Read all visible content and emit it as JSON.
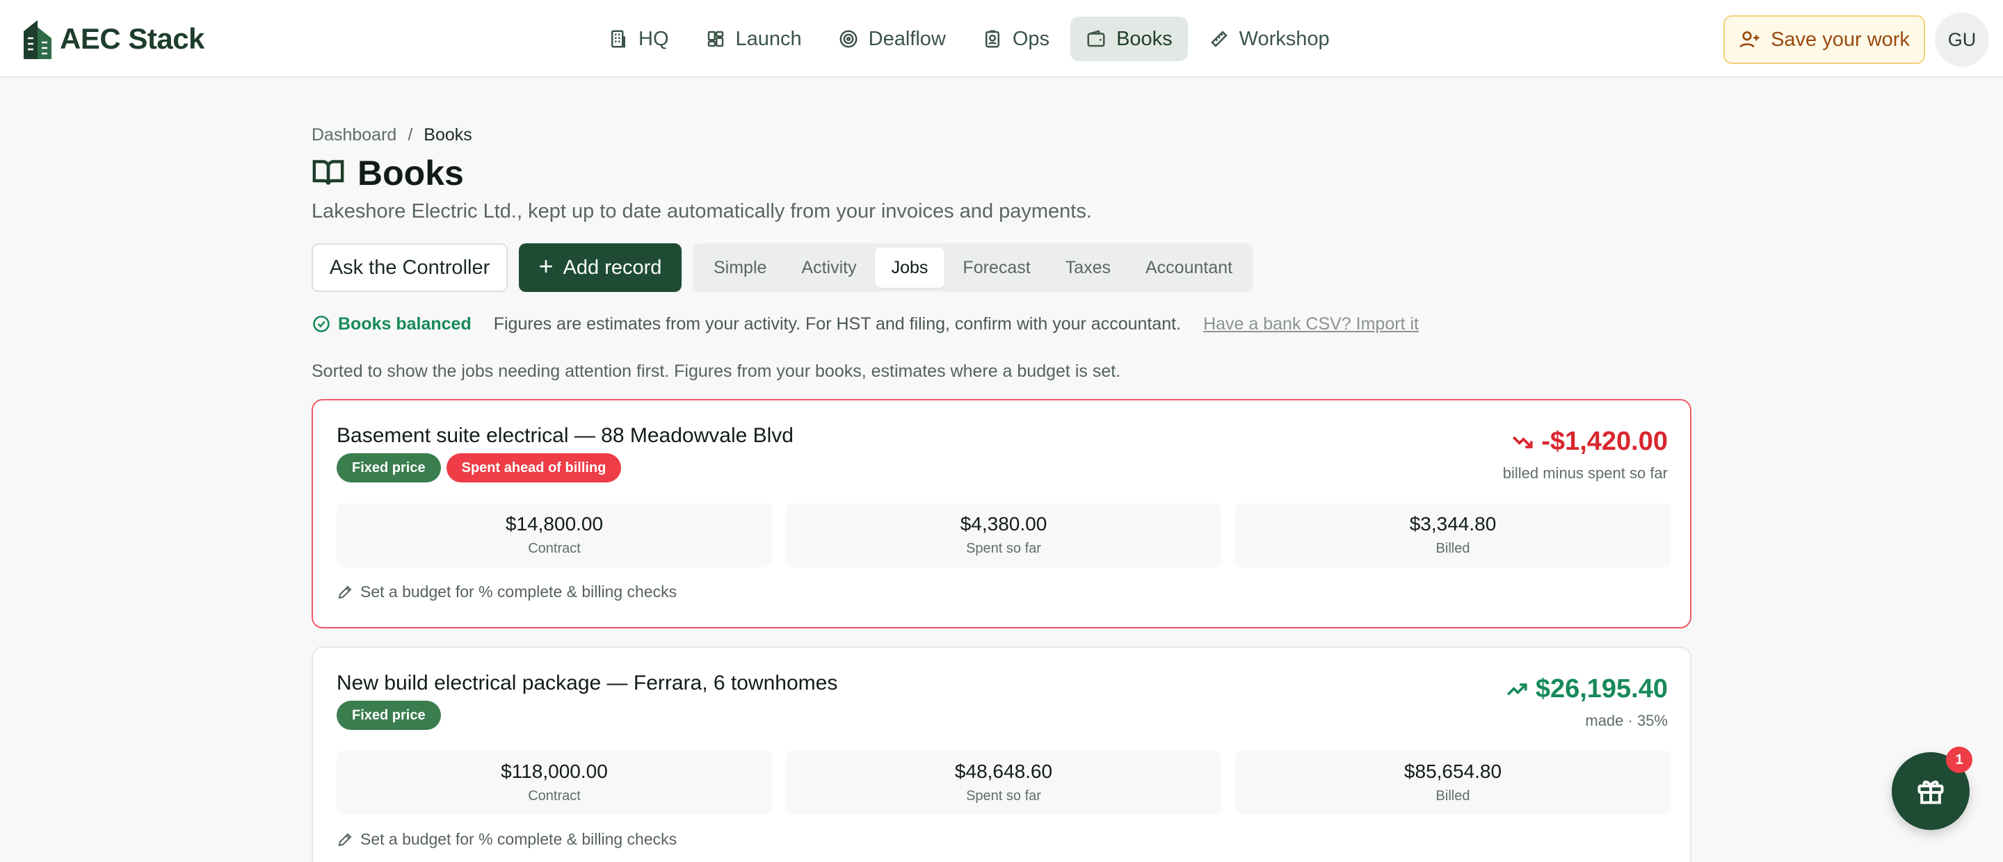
{
  "app": {
    "name": "AEC Stack"
  },
  "nav": {
    "items": [
      {
        "label": "HQ",
        "icon": "building-icon",
        "active": false
      },
      {
        "label": "Launch",
        "icon": "grid-icon",
        "active": false
      },
      {
        "label": "Dealflow",
        "icon": "target-icon",
        "active": false
      },
      {
        "label": "Ops",
        "icon": "id-badge-icon",
        "active": false
      },
      {
        "label": "Books",
        "icon": "wallet-icon",
        "active": true
      },
      {
        "label": "Workshop",
        "icon": "ruler-icon",
        "active": false
      }
    ]
  },
  "header": {
    "save_label": "Save your work",
    "avatar_initials": "GU"
  },
  "breadcrumb": {
    "root": "Dashboard",
    "separator": "/",
    "current": "Books"
  },
  "page": {
    "title": "Books",
    "subtitle": "Lakeshore Electric Ltd., kept up to date automatically from your invoices and payments."
  },
  "actions": {
    "ask_label": "Ask the Controller",
    "add_label": "Add record",
    "add_icon": "+"
  },
  "tabs": [
    {
      "label": "Simple",
      "active": false
    },
    {
      "label": "Activity",
      "active": false
    },
    {
      "label": "Jobs",
      "active": true
    },
    {
      "label": "Forecast",
      "active": false
    },
    {
      "label": "Taxes",
      "active": false
    },
    {
      "label": "Accountant",
      "active": false
    }
  ],
  "status": {
    "balanced": "Books balanced",
    "note": "Figures are estimates from your activity. For HST and filing, confirm with your accountant.",
    "import_link": "Have a bank CSV? Import it"
  },
  "sort_note": "Sorted to show the jobs needing attention first. Figures from your books, estimates where a budget is set.",
  "jobs": [
    {
      "title": "Basement suite electrical — 88 Meadowvale Blvd",
      "badges": [
        {
          "label": "Fixed price",
          "color": "#3a7d4e"
        },
        {
          "label": "Spent ahead of billing",
          "color": "#ee3d47"
        }
      ],
      "amount": "-$1,420.00",
      "amount_caption": "billed minus spent so far",
      "trend": "down",
      "stats": [
        {
          "value": "$14,800.00",
          "label": "Contract"
        },
        {
          "value": "$4,380.00",
          "label": "Spent so far"
        },
        {
          "value": "$3,344.80",
          "label": "Billed"
        }
      ],
      "budget_link": "Set a budget for % complete & billing checks"
    },
    {
      "title": "New build electrical package — Ferrara, 6 townhomes",
      "badges": [
        {
          "label": "Fixed price",
          "color": "#3a7d4e"
        }
      ],
      "amount": "$26,195.40",
      "amount_caption": "made · 35%",
      "trend": "up",
      "stats": [
        {
          "value": "$118,000.00",
          "label": "Contract"
        },
        {
          "value": "$48,648.60",
          "label": "Spent so far"
        },
        {
          "value": "$85,654.80",
          "label": "Billed"
        }
      ],
      "budget_link": "Set a budget for % complete & billing checks"
    }
  ],
  "gift": {
    "badge_count": "1",
    "icon": "gift-icon"
  },
  "colors": {
    "brand": "#1f4b35",
    "positive": "#178a5a",
    "negative": "#d9262e",
    "alert_border": "#ef5a64"
  }
}
